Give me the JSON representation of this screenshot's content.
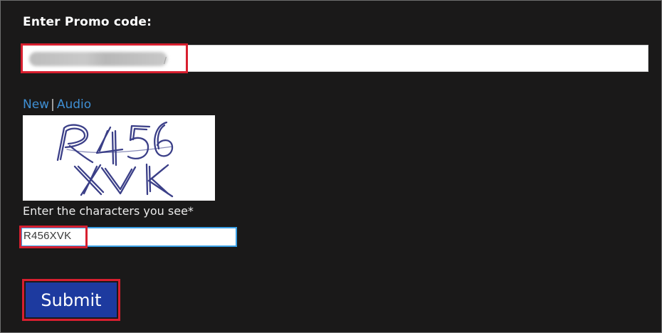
{
  "promo": {
    "label": "Enter Promo code:",
    "value_visible": "/",
    "highlight_color": "#d81f2f"
  },
  "captcha": {
    "links": [
      {
        "label": "New"
      },
      {
        "label": "Audio"
      }
    ],
    "separator": "|",
    "image_text": "R456 XVK",
    "instruction": "Enter the characters you see*",
    "value": "R456XVK",
    "link_color": "#3f8fd4"
  },
  "submit": {
    "label": "Submit",
    "color": "#1d3a9f"
  },
  "theme": {
    "background": "#1a1919",
    "input_focus_border": "#3aa0e6"
  }
}
